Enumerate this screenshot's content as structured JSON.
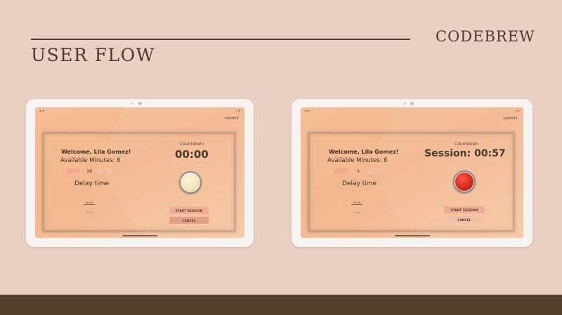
{
  "slide": {
    "title": "USER FLOW",
    "brand": "CODEBREW"
  },
  "screens": [
    {
      "logout_label": "LOGOUT",
      "welcome": "Welcome, Lila Gomez!",
      "available_minutes": "Available Minutes: 6",
      "stepper_minus": "-",
      "stepper_value": "10",
      "stepper_plus": "+",
      "delay_label": "Delay time",
      "time_input_value": "00:00",
      "time_sub": "00:00",
      "countdown_label": "Countdown",
      "countdown_time": "00:00",
      "record_state": "idle",
      "start_label": "START SESSION",
      "cancel_label": "CANCEL"
    },
    {
      "logout_label": "LOGOUT",
      "welcome": "Welcome, Lila Gomez!",
      "available_minutes": "Available Minutes: 6",
      "stepper_minus": "-",
      "stepper_value": "1",
      "stepper_plus": "+",
      "delay_label": "Delay time",
      "time_input_value": "00:00",
      "time_sub": "00:00",
      "countdown_label": "Countdown",
      "countdown_time": "Session: 00:57",
      "record_state": "active",
      "start_label": "START SESSION",
      "cancel_label": "CANCEL"
    }
  ],
  "colors": {
    "background": "#eacfc3",
    "text_dark": "#4e3a2c",
    "footer": "#55402b",
    "screen_accent": "#f6be95",
    "record_active": "#d01c10",
    "record_idle": "#f2e3b4"
  }
}
